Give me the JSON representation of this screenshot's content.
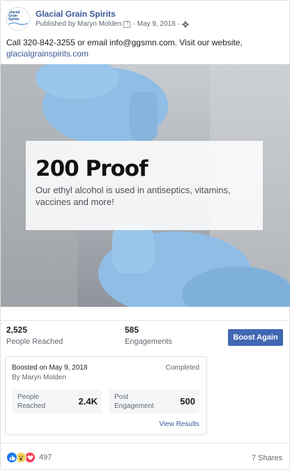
{
  "header": {
    "page_name": "Glacial Grain Spirits",
    "published_by": "Published by Maryn Molden",
    "help_glyph": "?",
    "separator": "·",
    "date": "May 9, 2018",
    "logo_text": "Glacial Grain Spirits"
  },
  "post": {
    "text": "Call 320-842-3255 or email info@ggsmn.com. Visit our website,",
    "link": "glacialgrainspirits.com"
  },
  "image": {
    "headline": "200 Proof",
    "caption": "Our ethyl alcohol is used in antiseptics, vitamins, vaccines and more!",
    "glove_color": "#8fbde6"
  },
  "stats": {
    "reached_value": "2,525",
    "reached_label": "People Reached",
    "engagements_value": "585",
    "engagements_label": "Engagements",
    "boost_button": "Boost Again"
  },
  "boost": {
    "title": "Boosted on May 9, 2018",
    "by": "By Maryn Molden",
    "status": "Completed",
    "metrics": [
      {
        "label": "People Reached",
        "value": "2.4K"
      },
      {
        "label": "Post Engagement",
        "value": "500"
      }
    ],
    "view_results": "View Results"
  },
  "footer": {
    "reaction_count": "497",
    "shares": "7 Shares",
    "reaction_icons": [
      "like-icon",
      "wow-icon",
      "love-icon"
    ]
  },
  "colors": {
    "link": "#385898",
    "button": "#4267b2"
  }
}
